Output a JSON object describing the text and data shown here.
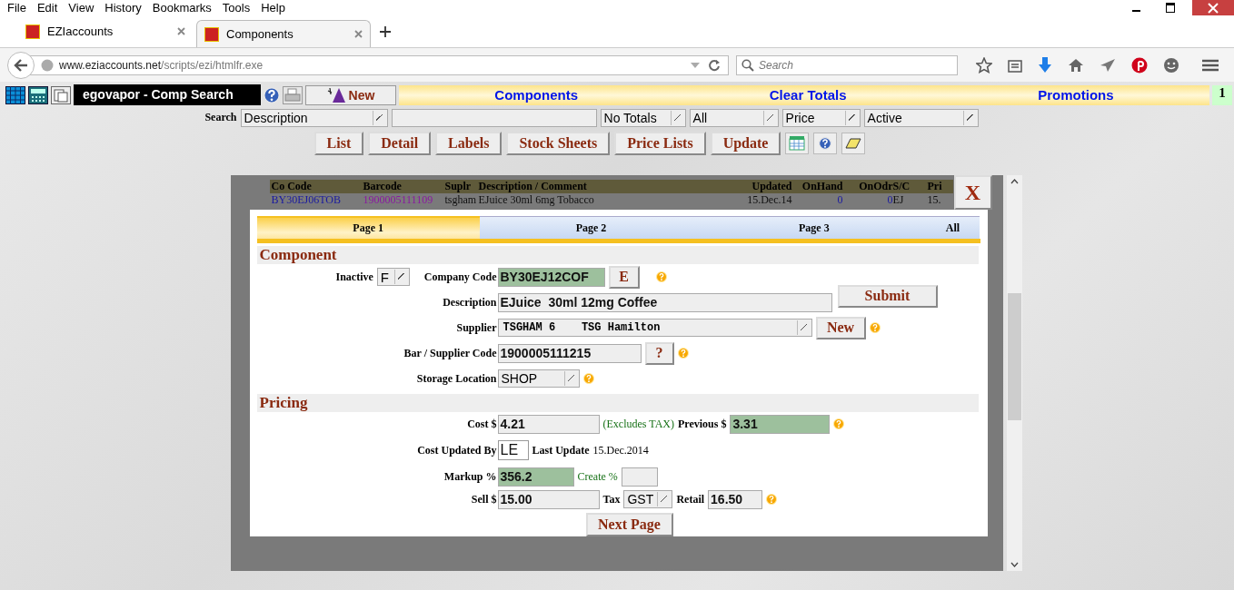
{
  "menu": [
    "File",
    "Edit",
    "View",
    "History",
    "Bookmarks",
    "Tools",
    "Help"
  ],
  "tabs": [
    {
      "label": "EZIaccounts",
      "selected": false
    },
    {
      "label": "Components",
      "selected": true
    }
  ],
  "address": {
    "host": "www.eziaccounts.net",
    "path": "/scripts/ezi/htmlfr.exe"
  },
  "search": {
    "placeholder": "Search"
  },
  "app_bar": {
    "title": "egovapor - Comp Search",
    "new_label": "New",
    "links": [
      "Components",
      "Clear Totals",
      "Promotions"
    ],
    "counter": "1"
  },
  "search_row": {
    "label": "Search",
    "selects": [
      "Description",
      "No Totals",
      "All",
      "Price",
      "Active"
    ]
  },
  "actions": [
    "List",
    "Detail",
    "Labels",
    "Stock Sheets",
    "Price Lists",
    "Update"
  ],
  "list": {
    "columns": [
      "Co Code",
      "Barcode",
      "Suplr",
      "Description / Comment",
      "Updated",
      "OnHand",
      "OnOdr",
      "S/C",
      "Pri"
    ],
    "row": [
      "BY30EJ06TOB",
      "1900005111109",
      "tsgham",
      "EJuice 30ml 6mg Tobacco",
      "15.Dec.14",
      "0",
      "0",
      "EJ",
      "15."
    ]
  },
  "close_label": "X",
  "page_tabs": [
    {
      "label": "Page 1",
      "selected": true
    },
    {
      "label": "Page 2",
      "selected": false
    },
    {
      "label": "Page 3",
      "selected": false
    },
    {
      "label": "All",
      "selected": false
    }
  ],
  "component": {
    "heading": "Component",
    "inactive": {
      "label": "Inactive",
      "value": "F"
    },
    "company_code": {
      "label": "Company Code",
      "value": "BY30EJ12COF",
      "highlighted": true,
      "button": "E"
    },
    "description": {
      "label": "Description",
      "value": "EJuice  30ml 12mg Coffee",
      "highlighted": false
    },
    "submit": "Submit",
    "supplier": {
      "label": "Supplier",
      "value": "TSGHAM 6    TSG Hamilton",
      "button": "New"
    },
    "bar_code": {
      "label": "Bar / Supplier Code",
      "value": "1900005111215",
      "highlighted": false,
      "button": "?"
    },
    "storage": {
      "label": "Storage Location",
      "value": "SHOP"
    }
  },
  "pricing": {
    "heading": "Pricing",
    "cost": {
      "label": "Cost $",
      "value": "4.21",
      "highlighted": false
    },
    "cost_note": "(Excludes TAX)",
    "previous": {
      "label": "Previous $",
      "value": "3.31",
      "highlighted": true
    },
    "updated_by": {
      "label": "Cost Updated By",
      "value": "LE"
    },
    "last_update": {
      "label": "Last Update",
      "value": "15.Dec.2014"
    },
    "markup": {
      "label": "Markup %",
      "value": "356.2",
      "highlighted": true
    },
    "create": {
      "label": "Create %",
      "highlighted": false
    },
    "sell": {
      "label": "Sell $",
      "value": "15.00",
      "highlighted": false
    },
    "tax": {
      "label": "Tax",
      "value": "GST"
    },
    "retail": {
      "label": "Retail",
      "value": "16.50",
      "highlighted": false
    },
    "next": "Next Page"
  }
}
